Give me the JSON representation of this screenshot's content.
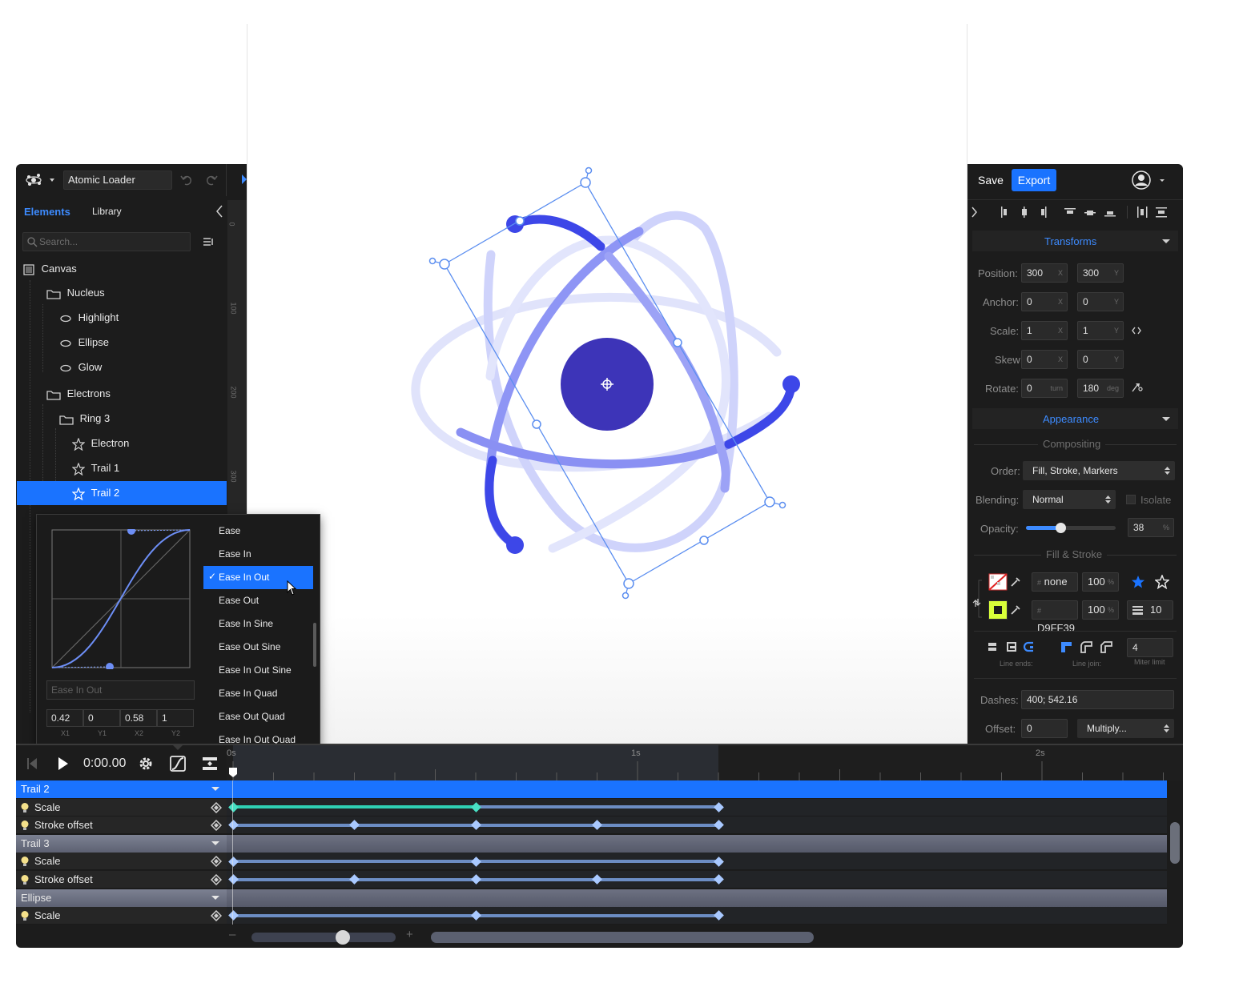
{
  "project": {
    "name": "Atomic Loader"
  },
  "header": {
    "save_label": "Save",
    "export_label": "Export"
  },
  "left_panel": {
    "tabs": [
      {
        "label": "Elements"
      },
      {
        "label": "Library"
      }
    ],
    "search_placeholder": "Search...",
    "tree": [
      {
        "label": "Canvas"
      },
      {
        "label": "Nucleus"
      },
      {
        "label": "Highlight"
      },
      {
        "label": "Ellipse"
      },
      {
        "label": "Glow"
      },
      {
        "label": "Electrons"
      },
      {
        "label": "Ring 3"
      },
      {
        "label": "Electron"
      },
      {
        "label": "Trail 1"
      },
      {
        "label": "Trail 2"
      }
    ]
  },
  "ruler": {
    "labels": [
      "0",
      "100",
      "200",
      "300"
    ]
  },
  "easing": {
    "name_placeholder": "Ease In Out",
    "x1": "0.42",
    "y1": "0",
    "x2": "0.58",
    "y2": "1",
    "param_labels": [
      "X1",
      "Y1",
      "X2",
      "Y2"
    ],
    "options": [
      "Ease",
      "Ease In",
      "Ease In Out",
      "Ease Out",
      "Ease In Sine",
      "Ease Out Sine",
      "Ease In Out Sine",
      "Ease In Quad",
      "Ease Out Quad",
      "Ease In Out Quad"
    ],
    "selected_index": 2
  },
  "right_panel": {
    "transforms": {
      "title": "Transforms",
      "position": {
        "label": "Position:",
        "x": "300",
        "y": "300"
      },
      "anchor": {
        "label": "Anchor:",
        "x": "0",
        "y": "0"
      },
      "scale": {
        "label": "Scale:",
        "x": "1",
        "y": "1"
      },
      "skew": {
        "label": "Skew:",
        "x": "0",
        "y": "0"
      },
      "rotate": {
        "label": "Rotate:",
        "turn": "0",
        "deg": "180",
        "turn_unit": "turn",
        "deg_unit": "deg"
      },
      "axis_x": "X",
      "axis_y": "Y"
    },
    "appearance": {
      "title": "Appearance",
      "compositing_label": "Compositing",
      "order_label": "Order:",
      "order_value": "Fill, Stroke, Markers",
      "blending_label": "Blending:",
      "blending_value": "Normal",
      "isolate_label": "Isolate",
      "opacity_label": "Opacity:",
      "opacity_value": "38",
      "opacity_fraction": 0.38,
      "percent": "%",
      "fill_stroke_label": "Fill & Stroke",
      "fill": {
        "hex": "none",
        "opacity": "100",
        "hash": "#"
      },
      "stroke": {
        "hex": "D9FF39",
        "opacity": "100",
        "width": "10",
        "color": "#D9FF39"
      },
      "line_ends_label": "Line ends:",
      "line_join_label": "Line join:",
      "miter_value": "4",
      "miter_label": "Miter limit",
      "dashes_label": "Dashes:",
      "dashes_value": "400; 542.16",
      "offset_label": "Offset:",
      "offset_value": "0",
      "offset_mode": "Multiply..."
    }
  },
  "timeline": {
    "time": "0:00.00",
    "ruler_labels": [
      "0s",
      "1s",
      "2s"
    ],
    "rows": [
      {
        "label": "Trail 2",
        "kind": "group"
      },
      {
        "label": "Scale",
        "kind": "prop"
      },
      {
        "label": "Stroke offset",
        "kind": "prop"
      },
      {
        "label": "Trail 3",
        "kind": "group"
      },
      {
        "label": "Scale",
        "kind": "prop"
      },
      {
        "label": "Stroke offset",
        "kind": "prop"
      },
      {
        "label": "Ellipse",
        "kind": "group"
      },
      {
        "label": "Scale",
        "kind": "prop"
      }
    ],
    "zoom_minus": "–",
    "zoom_plus": "+"
  },
  "colors": {
    "accent": "#1a73ff",
    "nucleus": "#3d34b8",
    "orbit": "#5560f0",
    "selection": "#5b8ef0"
  }
}
